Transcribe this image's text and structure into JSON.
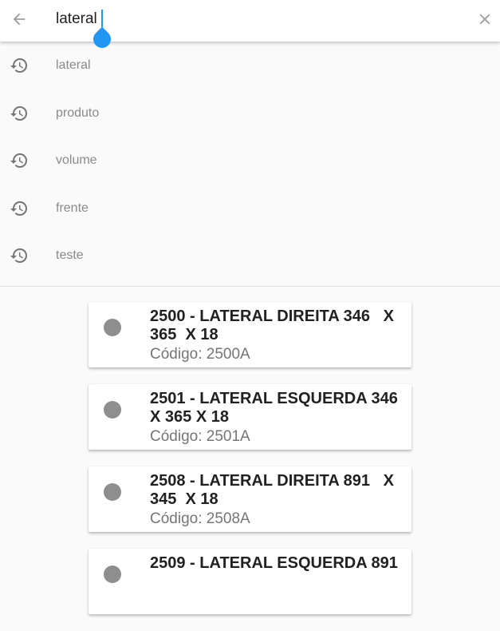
{
  "search": {
    "value": "lateral"
  },
  "history": [
    {
      "label": "lateral"
    },
    {
      "label": "produto"
    },
    {
      "label": "volume"
    },
    {
      "label": "frente"
    },
    {
      "label": "teste"
    }
  ],
  "results": [
    {
      "title": "2500 - LATERAL DIREITA 346   X\n365  X 18",
      "code": "Código: 2500A"
    },
    {
      "title": "2501 - LATERAL ESQUERDA 346\nX 365 X 18",
      "code": "Código: 2501A"
    },
    {
      "title": "2508 - LATERAL DIREITA 891   X\n345  X 18",
      "code": "Código: 2508A"
    },
    {
      "title": "2509 - LATERAL ESQUERDA 891",
      "code": ""
    }
  ],
  "colors": {
    "accent": "#2196f3",
    "dot": "#8e8e8e",
    "background": "#fafafa"
  },
  "icons": {
    "back": "arrow-back-icon",
    "clear": "close-icon",
    "history": "history-icon"
  }
}
